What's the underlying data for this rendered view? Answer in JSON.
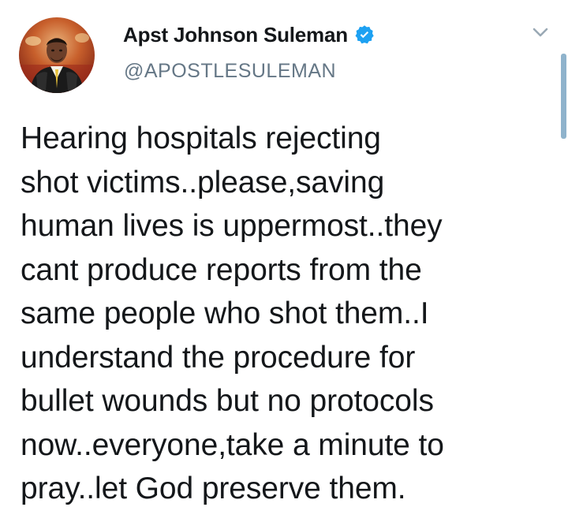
{
  "tweet": {
    "author": {
      "display_name": "Apst Johnson Suleman",
      "handle": "@APOSTLESULEMAN",
      "verified": true,
      "avatar_icon": "profile-photo"
    },
    "menu_icon": "chevron-down-icon",
    "text_lines": [
      "Hearing hospitals rejecting",
      "shot victims..please,saving",
      "human lives is uppermost..they",
      "cant produce reports from the",
      "same people who shot them..I",
      "understand the procedure for",
      "bullet wounds but no protocols",
      "now..everyone,take a minute to",
      "pray..let God preserve them."
    ]
  },
  "colors": {
    "text": "#14171a",
    "secondary_text": "#657786",
    "verified_blue": "#1da1f2",
    "caret": "#9aa9b5",
    "scrollbar": "#8fb3cc"
  }
}
